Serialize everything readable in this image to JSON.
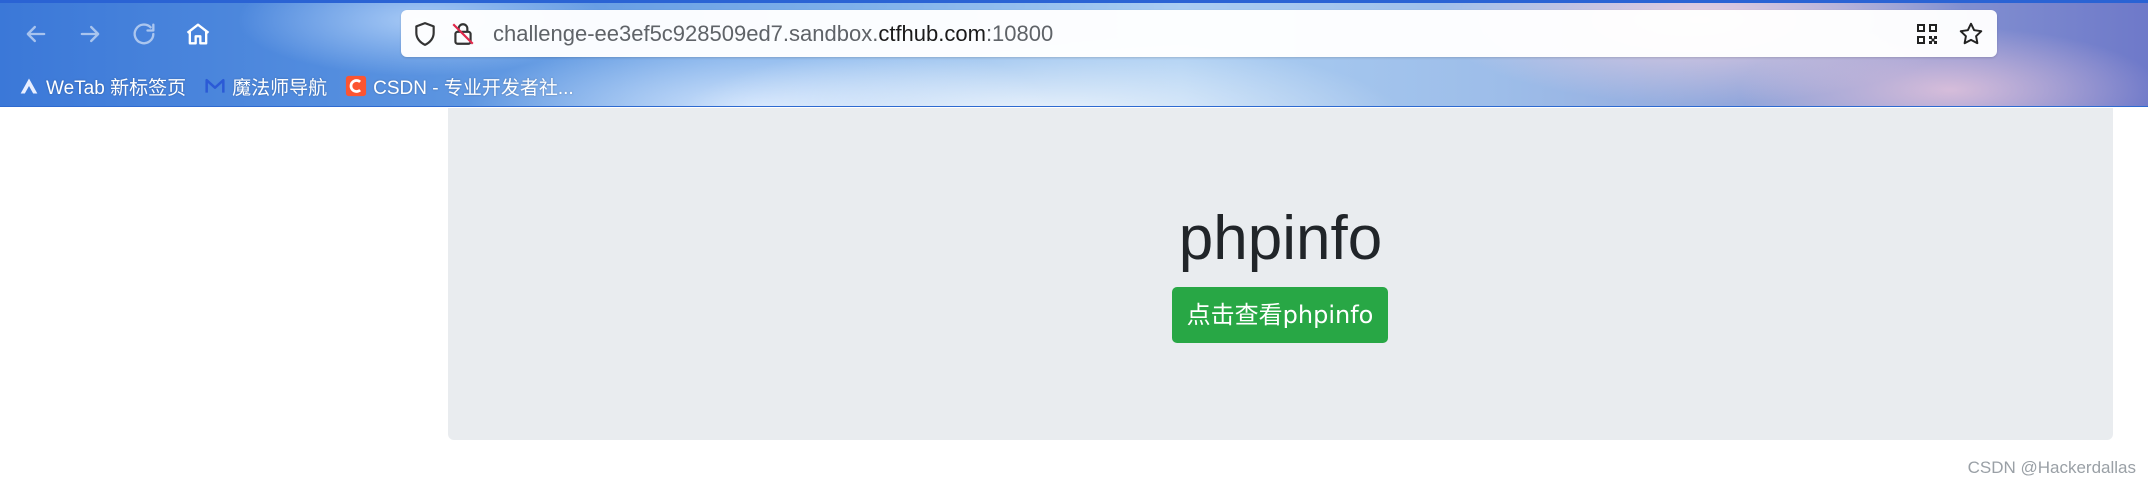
{
  "browser": {
    "url_prefix": "challenge-ee3ef5c928509ed7.sandbox.",
    "url_domain": "ctfhub.com",
    "url_port": ":10800",
    "nav_icons": [
      "back-arrow-icon",
      "forward-arrow-icon",
      "reload-icon",
      "home-icon"
    ],
    "url_icons": [
      "shield-icon",
      "insecure-lock-icon",
      "qr-code-icon",
      "star-icon"
    ],
    "bookmarks": [
      {
        "label": "WeTab 新标签页",
        "icon": "wetab-logo-icon",
        "color": "#e8eeff"
      },
      {
        "label": "魔法师导航",
        "icon": "mofashi-logo-icon",
        "color": "#2b5ad6"
      },
      {
        "label": "CSDN - 专业开发者社...",
        "icon": "csdn-logo-icon",
        "color": "#fc5531"
      }
    ]
  },
  "page": {
    "title": "phpinfo",
    "button_label": "点击查看phpinfo",
    "accent_color": "#28a745"
  },
  "watermark": "CSDN @Hackerdallas"
}
